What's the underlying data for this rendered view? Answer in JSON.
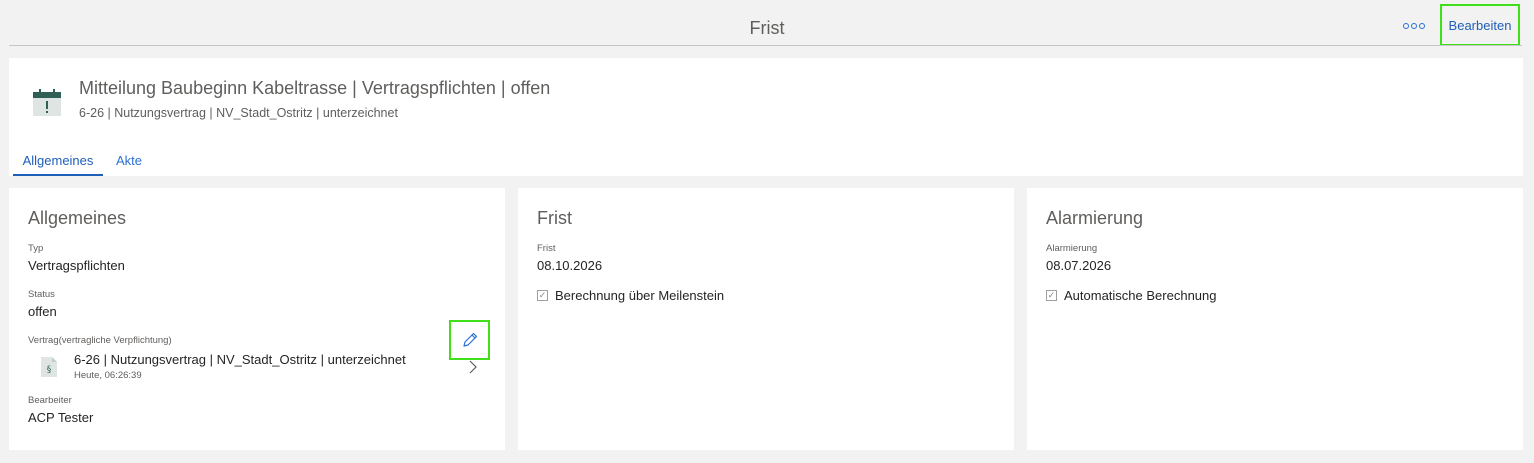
{
  "header": {
    "title": "Frist",
    "more_label": "ooo",
    "edit_label": "Bearbeiten"
  },
  "record": {
    "icon": "calendar-alert-icon",
    "title": "Mitteilung Baubeginn Kabeltrasse | Vertragspflichten | offen",
    "subtitle": "6-26 | Nutzungsvertrag | NV_Stadt_Ostritz | unterzeichnet",
    "tabs": [
      {
        "label": "Allgemeines",
        "active": true
      },
      {
        "label": "Akte",
        "active": false
      }
    ]
  },
  "general": {
    "title": "Allgemeines",
    "type_label": "Typ",
    "type_value": "Vertragspflichten",
    "status_label": "Status",
    "status_value": "offen",
    "contract_label": "Vertrag(vertragliche Verpflichtung)",
    "contract_icon": "paragraph-document-icon",
    "contract_title": "6-26 | Nutzungsvertrag | NV_Stadt_Ostritz | unterzeichnet",
    "contract_time": "Heute, 06:26:39",
    "editor_label": "Bearbeiter",
    "editor_value": "ACP Tester"
  },
  "deadline": {
    "title": "Frist",
    "date_label": "Frist",
    "date_value": "08.10.2026",
    "checkbox_label": "Berechnung über Meilenstein",
    "checkbox_checked": true
  },
  "alarm": {
    "title": "Alarmierung",
    "date_label": "Alarmierung",
    "date_value": "08.07.2026",
    "checkbox_label": "Automatische Berechnung",
    "checkbox_checked": true
  },
  "colors": {
    "accent": "#1f5fb8",
    "highlight": "#3fe01a",
    "icon_green": "#2f5f55"
  }
}
